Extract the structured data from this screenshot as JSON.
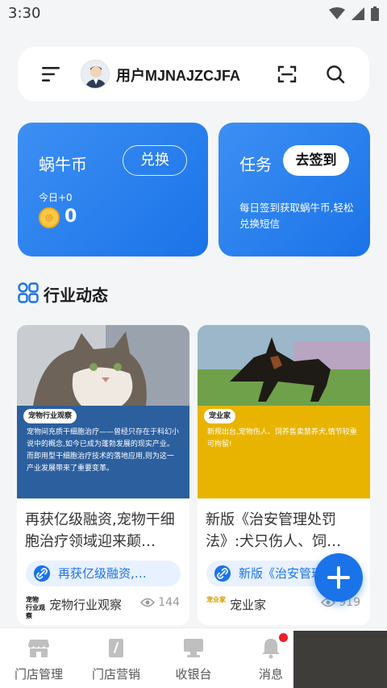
{
  "status_bar": {
    "time": "3:30"
  },
  "top_bar": {
    "username": "用户MJNAJZCJFA"
  },
  "coin_card": {
    "title": "蜗牛币",
    "exchange_label": "兑换",
    "today_label": "今日+0",
    "coin_value": "0"
  },
  "task_card": {
    "title": "任务",
    "checkin_label": "去签到",
    "description": "每日签到获取蜗牛币,轻松兑换短信"
  },
  "section": {
    "title": "行业动态"
  },
  "news": [
    {
      "thumb_tag": "宠物行业观察",
      "thumb_text": "宠物间充质干细胞治疗——曾经只存在于科幻小说中的概念,如今已成为蓬勃发展的现实产业。而即用型干细胞治疗技术的落地应用,则为这一产业发展带来了重要变革。",
      "title": "再获亿级融资,宠物干细胞治疗领域迎来颠…",
      "link_text": "再获亿级融资,…",
      "source_logo": "宠物 行业观察",
      "source": "宠物行业观察",
      "views": "144"
    },
    {
      "thumb_tag": "宠业家",
      "thumb_text": "新规出台,宠物伤人、饲养售卖禁养犬,情节较重可拘留!",
      "title": "新版《治安管理处罚法》:犬只伤人、饲…",
      "link_text": "新版《治安管理",
      "source_logo": "宠业家",
      "source": "宠业家",
      "views": "919"
    }
  ],
  "bottom_nav": [
    {
      "label": "门店管理"
    },
    {
      "label": "门店营销"
    },
    {
      "label": "收银台"
    },
    {
      "label": "消息"
    }
  ],
  "colors": {
    "accent": "#1a73e8",
    "coin": "#f7c948",
    "badge": "#ee1c25",
    "panel_blue": "#2b5f9e",
    "panel_yellow": "#e8b400"
  }
}
